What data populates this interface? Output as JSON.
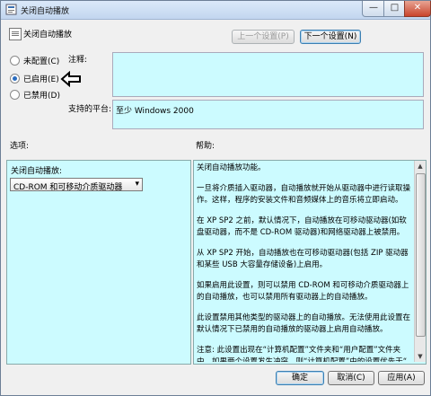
{
  "window": {
    "title": "关闭自动播放",
    "min": "—",
    "max": "□",
    "close": "✕"
  },
  "header": {
    "title": "关闭自动播放",
    "prev_button": "上一个设置(P)",
    "next_button": "下一个设置(N)"
  },
  "state": {
    "not_configured": "未配置(C)",
    "enabled": "已启用(E)",
    "disabled": "已禁用(D)",
    "selected": "enabled"
  },
  "comment_label": "注释:",
  "platform_label": "支持的平台:",
  "platform_value": "至少 Windows 2000",
  "options_label": "选项:",
  "help_label": "帮助:",
  "options": {
    "setting_label": "关闭自动播放:",
    "select_value": "CD-ROM 和可移动介质驱动器"
  },
  "help_paragraphs": [
    "关闭自动播放功能。",
    "一旦将介质插入驱动器，自动播放就开始从驱动器中进行读取操作。这样，程序的安装文件和音频媒体上的音乐将立即启动。",
    "在 XP SP2 之前，默认情况下，自动播放在可移动驱动器(如软盘驱动器，而不是 CD-ROM 驱动器)和网络驱动器上被禁用。",
    "从 XP SP2 开始，自动播放也在可移动驱动器(包括 ZIP 驱动器和某些 USB 大容量存储设备)上启用。",
    "如果启用此设置，则可以禁用 CD-ROM 和可移动介质驱动器上的自动播放，也可以禁用所有驱动器上的自动播放。",
    "此设置禁用其他类型的驱动器上的自动播放。无法使用此设置在默认情况下已禁用的自动播放的驱动器上启用自动播放。",
    "注意: 此设置出现在“计算机配置”文件夹和“用户配置”文件夹中。如果两个设置发生冲突，则“计算机配置”中的设置优先于“"
  ],
  "footer": {
    "ok": "确定",
    "cancel": "取消(C)",
    "apply": "应用(A)"
  }
}
